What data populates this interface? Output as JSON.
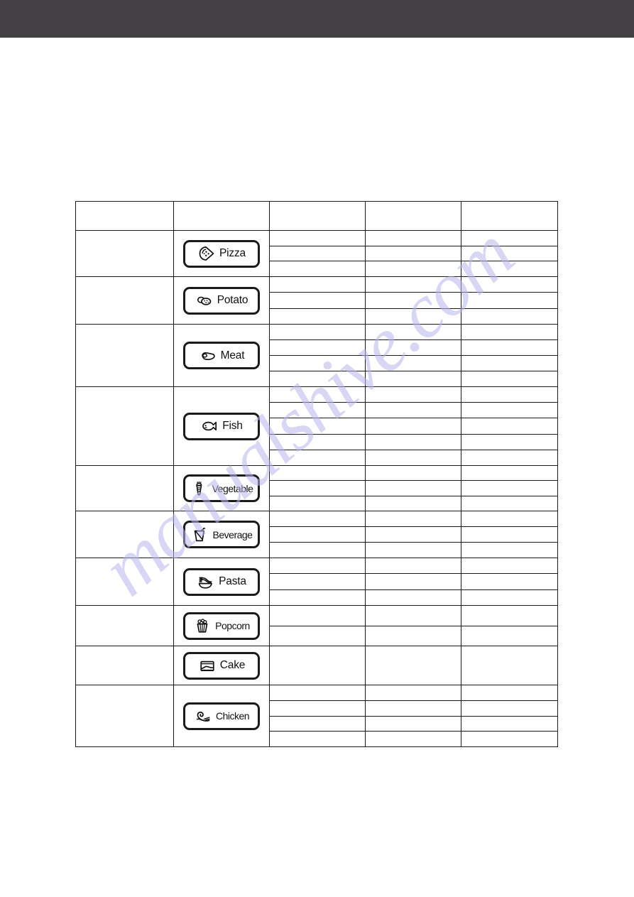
{
  "document": {
    "watermark_text": "manualshive.com",
    "watermark_color": "#b9b6ee",
    "header_band_color": "#434143",
    "table_border_color": "#1b1b1b",
    "page_background": "#ffffff"
  },
  "table": {
    "column_count": 5,
    "header_row": {
      "cells": [
        "",
        "",
        "",
        "",
        ""
      ]
    },
    "groups": [
      {
        "name": "pizza",
        "menu_cell": "",
        "button": {
          "label": "Pizza",
          "icon": "pizza-slice-icon"
        },
        "subrow_count": 3,
        "rows": [
          {
            "cells": [
              "",
              "",
              ""
            ]
          },
          {
            "cells": [
              "",
              "",
              ""
            ]
          },
          {
            "cells": [
              "",
              "",
              ""
            ]
          }
        ]
      },
      {
        "name": "potato",
        "menu_cell": "",
        "button": {
          "label": "Potato",
          "icon": "potato-icon"
        },
        "subrow_count": 3,
        "rows": [
          {
            "cells": [
              "",
              "",
              ""
            ]
          },
          {
            "cells": [
              "",
              "",
              ""
            ]
          },
          {
            "cells": [
              "",
              "",
              ""
            ]
          }
        ]
      },
      {
        "name": "meat",
        "menu_cell": "",
        "button": {
          "label": "Meat",
          "icon": "meat-steak-icon"
        },
        "subrow_count": 4,
        "rows": [
          {
            "cells": [
              "",
              "",
              ""
            ]
          },
          {
            "cells": [
              "",
              "",
              ""
            ]
          },
          {
            "cells": [
              "",
              "",
              ""
            ]
          },
          {
            "cells": [
              "",
              "",
              ""
            ]
          }
        ]
      },
      {
        "name": "fish",
        "menu_cell": "",
        "button": {
          "label": "Fish",
          "icon": "fish-icon"
        },
        "subrow_count": 5,
        "rows": [
          {
            "cells": [
              "",
              "",
              ""
            ]
          },
          {
            "cells": [
              "",
              "",
              ""
            ]
          },
          {
            "cells": [
              "",
              "",
              ""
            ]
          },
          {
            "cells": [
              "",
              "",
              ""
            ]
          },
          {
            "cells": [
              "",
              "",
              ""
            ]
          }
        ]
      },
      {
        "name": "vegetable",
        "menu_cell": "",
        "button": {
          "label": "Vegetable",
          "icon": "carrot-icon"
        },
        "subrow_count": 3,
        "rows": [
          {
            "cells": [
              "",
              "",
              ""
            ]
          },
          {
            "cells": [
              "",
              "",
              ""
            ]
          },
          {
            "cells": [
              "",
              "",
              ""
            ]
          }
        ]
      },
      {
        "name": "beverage",
        "menu_cell": "",
        "button": {
          "label": "Beverage",
          "icon": "drink-cup-icon"
        },
        "subrow_count": 3,
        "rows": [
          {
            "cells": [
              "",
              "",
              ""
            ]
          },
          {
            "cells": [
              "",
              "",
              ""
            ]
          },
          {
            "cells": [
              "",
              "",
              ""
            ]
          }
        ]
      },
      {
        "name": "pasta",
        "menu_cell": "",
        "button": {
          "label": "Pasta",
          "icon": "pasta-bowl-icon"
        },
        "subrow_count": 3,
        "rows": [
          {
            "cells": [
              "",
              "",
              ""
            ]
          },
          {
            "cells": [
              "",
              "",
              ""
            ]
          },
          {
            "cells": [
              "",
              "",
              ""
            ]
          }
        ]
      },
      {
        "name": "popcorn",
        "menu_cell": "",
        "button": {
          "label": "Popcorn",
          "icon": "popcorn-bucket-icon"
        },
        "subrow_count": 2,
        "rows": [
          {
            "cells": [
              "",
              "",
              ""
            ]
          },
          {
            "cells": [
              "",
              "",
              ""
            ]
          }
        ]
      },
      {
        "name": "cake",
        "menu_cell": "",
        "button": {
          "label": "Cake",
          "icon": "cake-icon"
        },
        "subrow_count": 1,
        "rows": [
          {
            "cells": [
              "",
              "",
              ""
            ]
          }
        ]
      },
      {
        "name": "chicken",
        "menu_cell": "",
        "button": {
          "label": "Chicken",
          "icon": "chicken-icon"
        },
        "subrow_count": 4,
        "rows": [
          {
            "cells": [
              "",
              "",
              ""
            ]
          },
          {
            "cells": [
              "",
              "",
              ""
            ]
          },
          {
            "cells": [
              "",
              "",
              ""
            ]
          },
          {
            "cells": [
              "",
              "",
              ""
            ]
          }
        ]
      }
    ]
  }
}
